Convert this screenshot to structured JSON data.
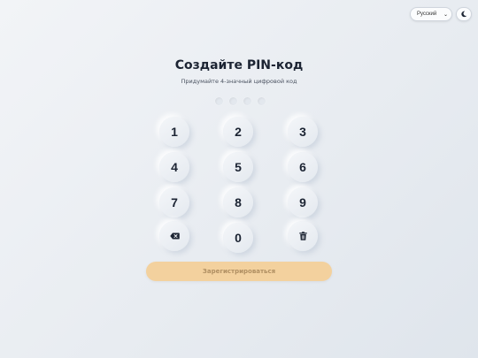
{
  "header": {
    "language": "Русский",
    "theme_icon": "moon-icon"
  },
  "main": {
    "title": "Создайте PIN-код",
    "subtitle": "Придумайте 4-значный цифровой код",
    "pin_length": 4,
    "pin_filled": 0
  },
  "keypad": {
    "k1": "1",
    "k2": "2",
    "k3": "3",
    "k4": "4",
    "k5": "5",
    "k6": "6",
    "k7": "7",
    "k8": "8",
    "k9": "9",
    "k0": "0",
    "backspace_icon": "backspace-icon",
    "clear_icon": "trash-icon"
  },
  "actions": {
    "register_label": "Зарегистрироваться"
  },
  "colors": {
    "accent": "#f3d19e",
    "text": "#1c2433"
  }
}
